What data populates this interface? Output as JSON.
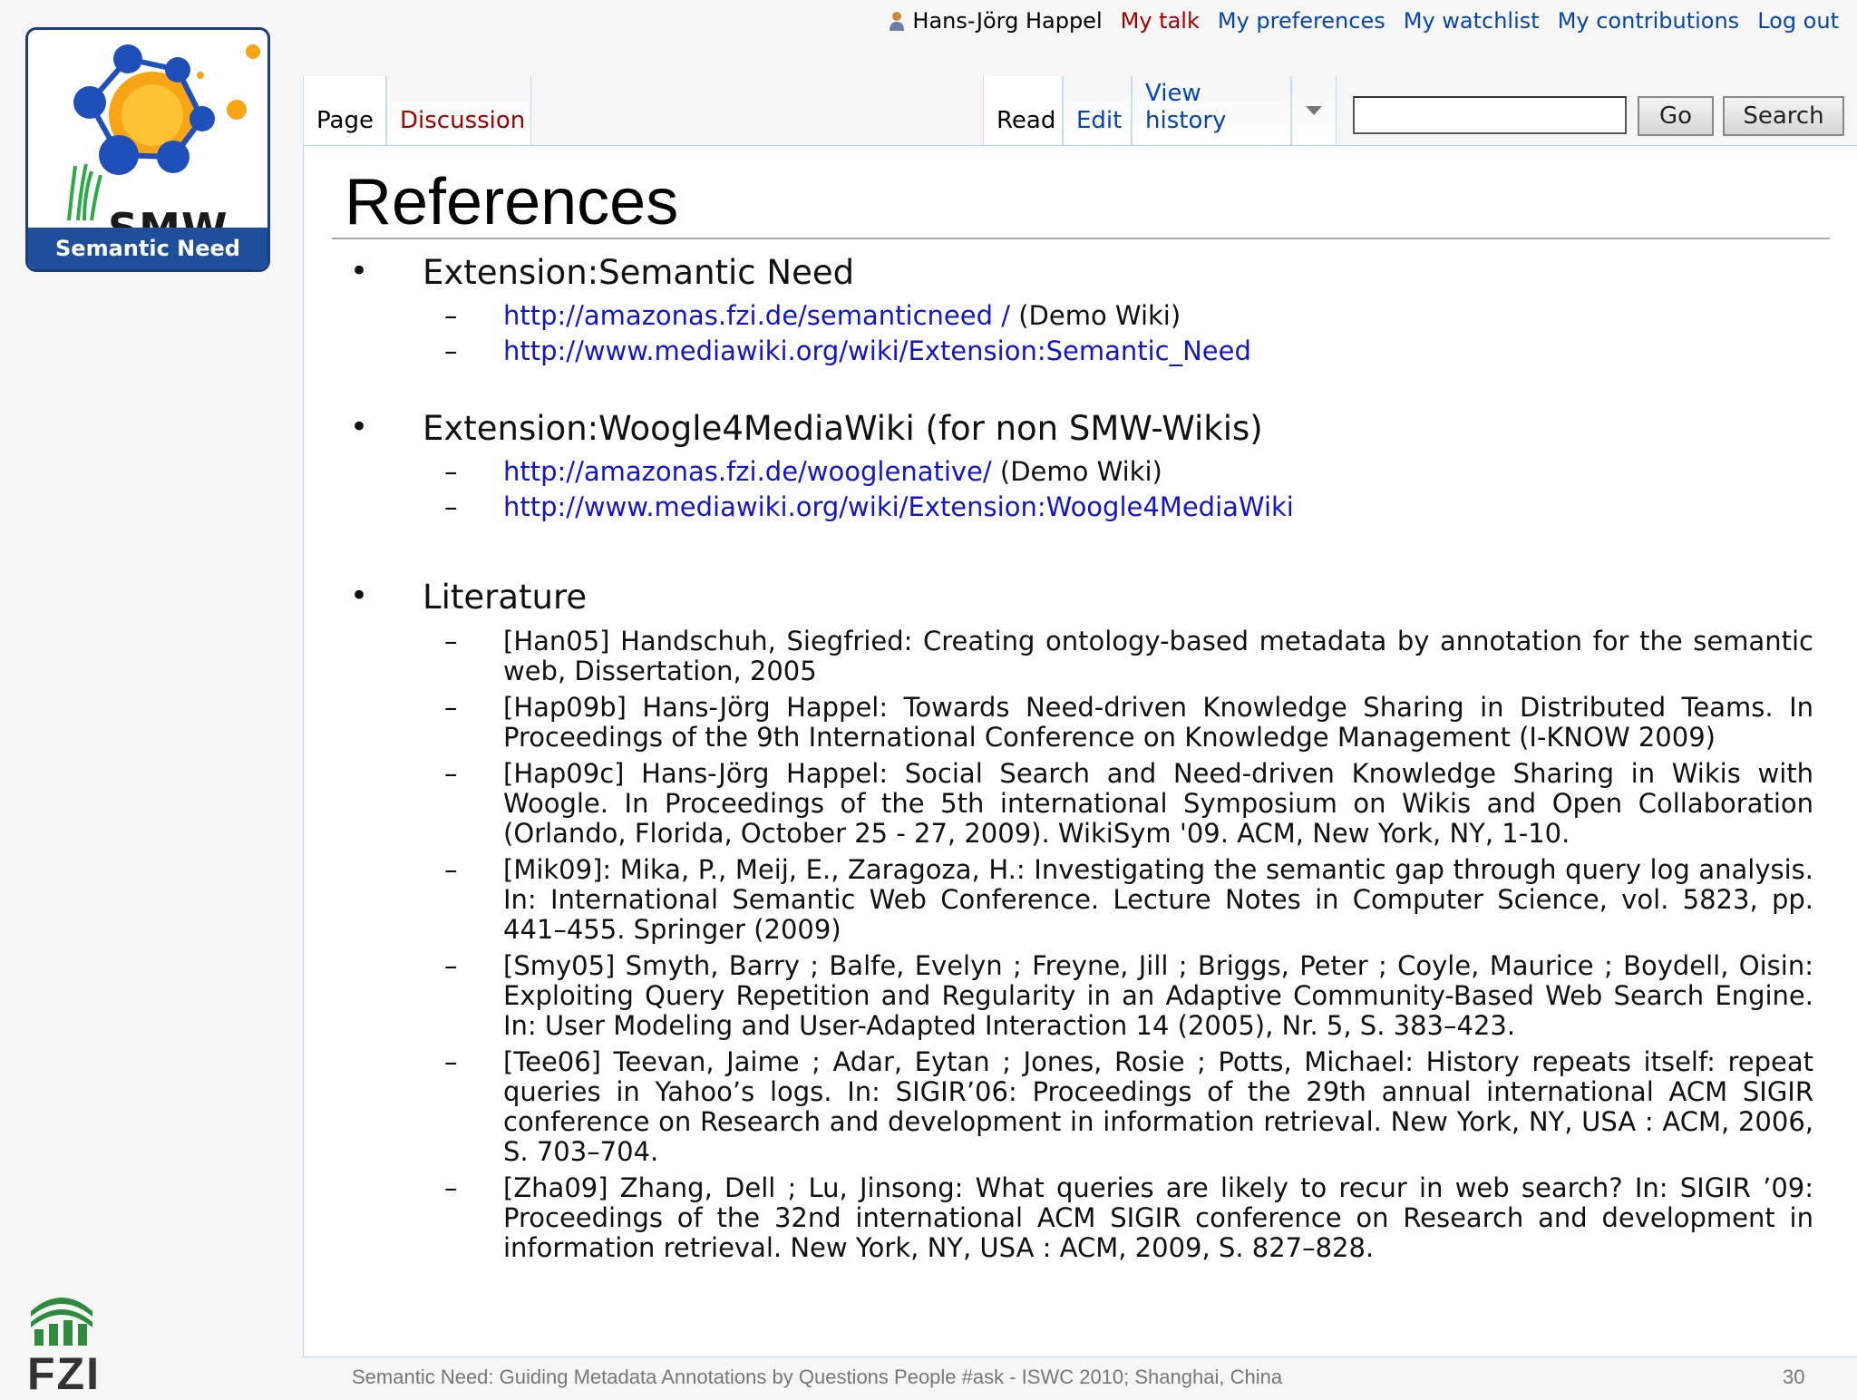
{
  "logo": {
    "smw_text": "SMW",
    "band_text": "Semantic Need",
    "colors": {
      "band": "#1f4f9a",
      "sun": "#f7a515",
      "nodes": "#1f4fb8"
    }
  },
  "personal_tools": {
    "user_icon": "user-icon",
    "username": "Hans-Jörg Happel",
    "my_talk": "My talk",
    "my_preferences": "My preferences",
    "my_watchlist": "My watchlist",
    "my_contributions": "My contributions",
    "log_out": "Log out"
  },
  "tabs": {
    "page": "Page",
    "discussion": "Discussion",
    "read": "Read",
    "edit": "Edit",
    "view_history": "View history",
    "more_icon": "triangle-down-icon"
  },
  "search": {
    "value": "",
    "go_label": "Go",
    "search_label": "Search"
  },
  "page": {
    "title": "References"
  },
  "sections": {
    "s1": {
      "heading": "Extension:Semantic Need",
      "l1_url": "http://amazonas.fzi.de/semanticneed /",
      "l1_note": "(Demo Wiki)",
      "l2_url": "http://www.mediawiki.org/wiki/Extension:Semantic_Need"
    },
    "s2": {
      "heading": "Extension:Woogle4MediaWiki (for non SMW-Wikis)",
      "l1_url": "http://amazonas.fzi.de/wooglenative/",
      "l1_note": "(Demo Wiki)",
      "l2_url": "http://www.mediawiki.org/wiki/Extension:Woogle4MediaWiki"
    },
    "s3": {
      "heading": "Literature",
      "items": [
        "[Han05] Handschuh, Siegfried: Creating ontology-based metadata by annotation for the semantic web, Dissertation, 2005",
        "[Hap09b] Hans-Jörg Happel: Towards Need-driven Knowledge Sharing in Distributed Teams. In Proceedings of the 9th International Conference on Knowledge Management (I-KNOW 2009)",
        "[Hap09c] Hans-Jörg Happel: Social Search and Need-driven Knowledge Sharing in Wikis with Woogle. In Proceedings of the 5th international Symposium on Wikis and Open Collaboration (Orlando, Florida, October 25 - 27, 2009). WikiSym '09. ACM, New York, NY, 1-10.",
        "[Mik09]: Mika, P., Meij, E., Zaragoza, H.: Investigating the semantic gap through query log analysis. In: International Semantic Web Conference. Lecture Notes in Computer Science, vol. 5823, pp. 441–455. Springer (2009)",
        "[Smy05] Smyth, Barry ; Balfe, Evelyn ; Freyne, Jill ; Briggs, Peter ; Coyle, Maurice ; Boydell, Oisin: Exploiting Query Repetition and Regularity in an Adaptive Community-Based Web Search Engine. In: User Modeling and User-Adapted Interaction 14 (2005), Nr. 5, S. 383–423.",
        "[Tee06] Teevan, Jaime ; Adar, Eytan ; Jones, Rosie ; Potts, Michael: History repeats itself: repeat queries in Yahoo’s logs. In: SIGIR’06: Proceedings of the 29th annual international ACM SIGIR conference on Research and development in information retrieval. New York, NY, USA : ACM, 2006, S. 703–704.",
        "[Zha09] Zhang, Dell ; Lu, Jinsong: What queries are likely to recur in web search? In: SIGIR ’09: Proceedings of the 32nd international ACM SIGIR conference on Research and development in information retrieval. New York, NY, USA : ACM, 2009, S. 827–828."
      ]
    }
  },
  "footer": {
    "text": "Semantic Need: Guiding Metadata Annotations by Questions People #ask - ISWC 2010; Shanghai, China",
    "page_number": "30",
    "org_logo_text": "FZI"
  },
  "symbols": {
    "bullet": "•",
    "dash": "–"
  }
}
